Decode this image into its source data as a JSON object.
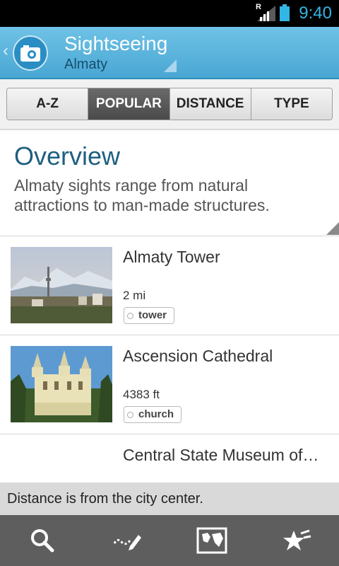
{
  "status_bar": {
    "time": "9:40",
    "signal_label": "R"
  },
  "action_bar": {
    "title": "Sightseeing",
    "subtitle": "Almaty"
  },
  "tabs": [
    {
      "label": "A-Z",
      "active": false
    },
    {
      "label": "POPULAR",
      "active": true
    },
    {
      "label": "DISTANCE",
      "active": false
    },
    {
      "label": "TYPE",
      "active": false
    }
  ],
  "overview": {
    "title": "Overview",
    "text": "Almaty sights range from natural attractions to man-made structures."
  },
  "items": [
    {
      "name": "Almaty Tower",
      "distance": "2 mi",
      "tag": "tower"
    },
    {
      "name": "Ascension Cathedral",
      "distance": "4383 ft",
      "tag": "church"
    },
    {
      "name": "Central State Museum of…"
    }
  ],
  "note": "Distance is from the city center.",
  "bottom_bar": {
    "buttons": [
      "search-icon",
      "edit-icon",
      "map-icon",
      "favorites-icon"
    ]
  },
  "colors": {
    "accent": "#33b5e5",
    "action_bar": "#5ab4dd",
    "overview_title": "#1f5f80"
  }
}
